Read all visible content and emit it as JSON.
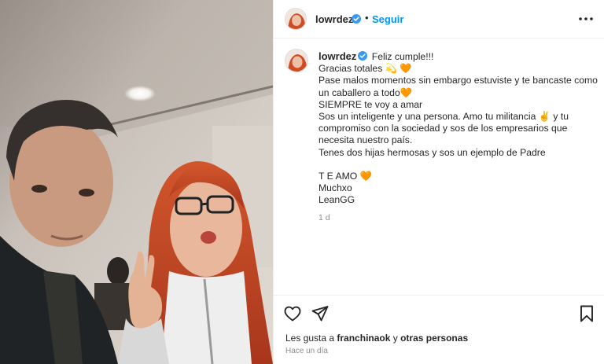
{
  "post": {
    "username": "lowrdez",
    "follow_label": "Seguir",
    "separator": "•",
    "caption_lines": [
      "Feliz cumple!!!",
      "Gracias totales 💫 🧡",
      "Pase malos momentos sin embargo estuviste y te bancaste como",
      "un caballero a todo🧡",
      "SIEMPRE te voy a amar",
      "Sos un inteligente y una persona. Amo tu militancia ✌️ y tu",
      "compromiso con la sociedad y sos de los empresarios que",
      "necesita nuestro país.",
      "Tenes dos hijas hermosas y sos un ejemplo de Padre",
      "",
      "T E AMO 🧡",
      "Muchxo",
      "LeanGG"
    ],
    "caption_age": "1 d",
    "likes_prefix": "Les gusta a ",
    "likes_user": "franchinaok",
    "likes_connector": " y ",
    "likes_others": "otras personas",
    "posted_ago": "Hace un día"
  },
  "icons": {
    "verified": "verified-badge-icon",
    "more": "more-options-icon",
    "like": "heart-icon",
    "share": "share-icon",
    "save": "bookmark-icon"
  },
  "colors": {
    "accent": "#0095f6",
    "verified": "#3897f0",
    "muted": "#8e8e8e",
    "text": "#262626"
  }
}
